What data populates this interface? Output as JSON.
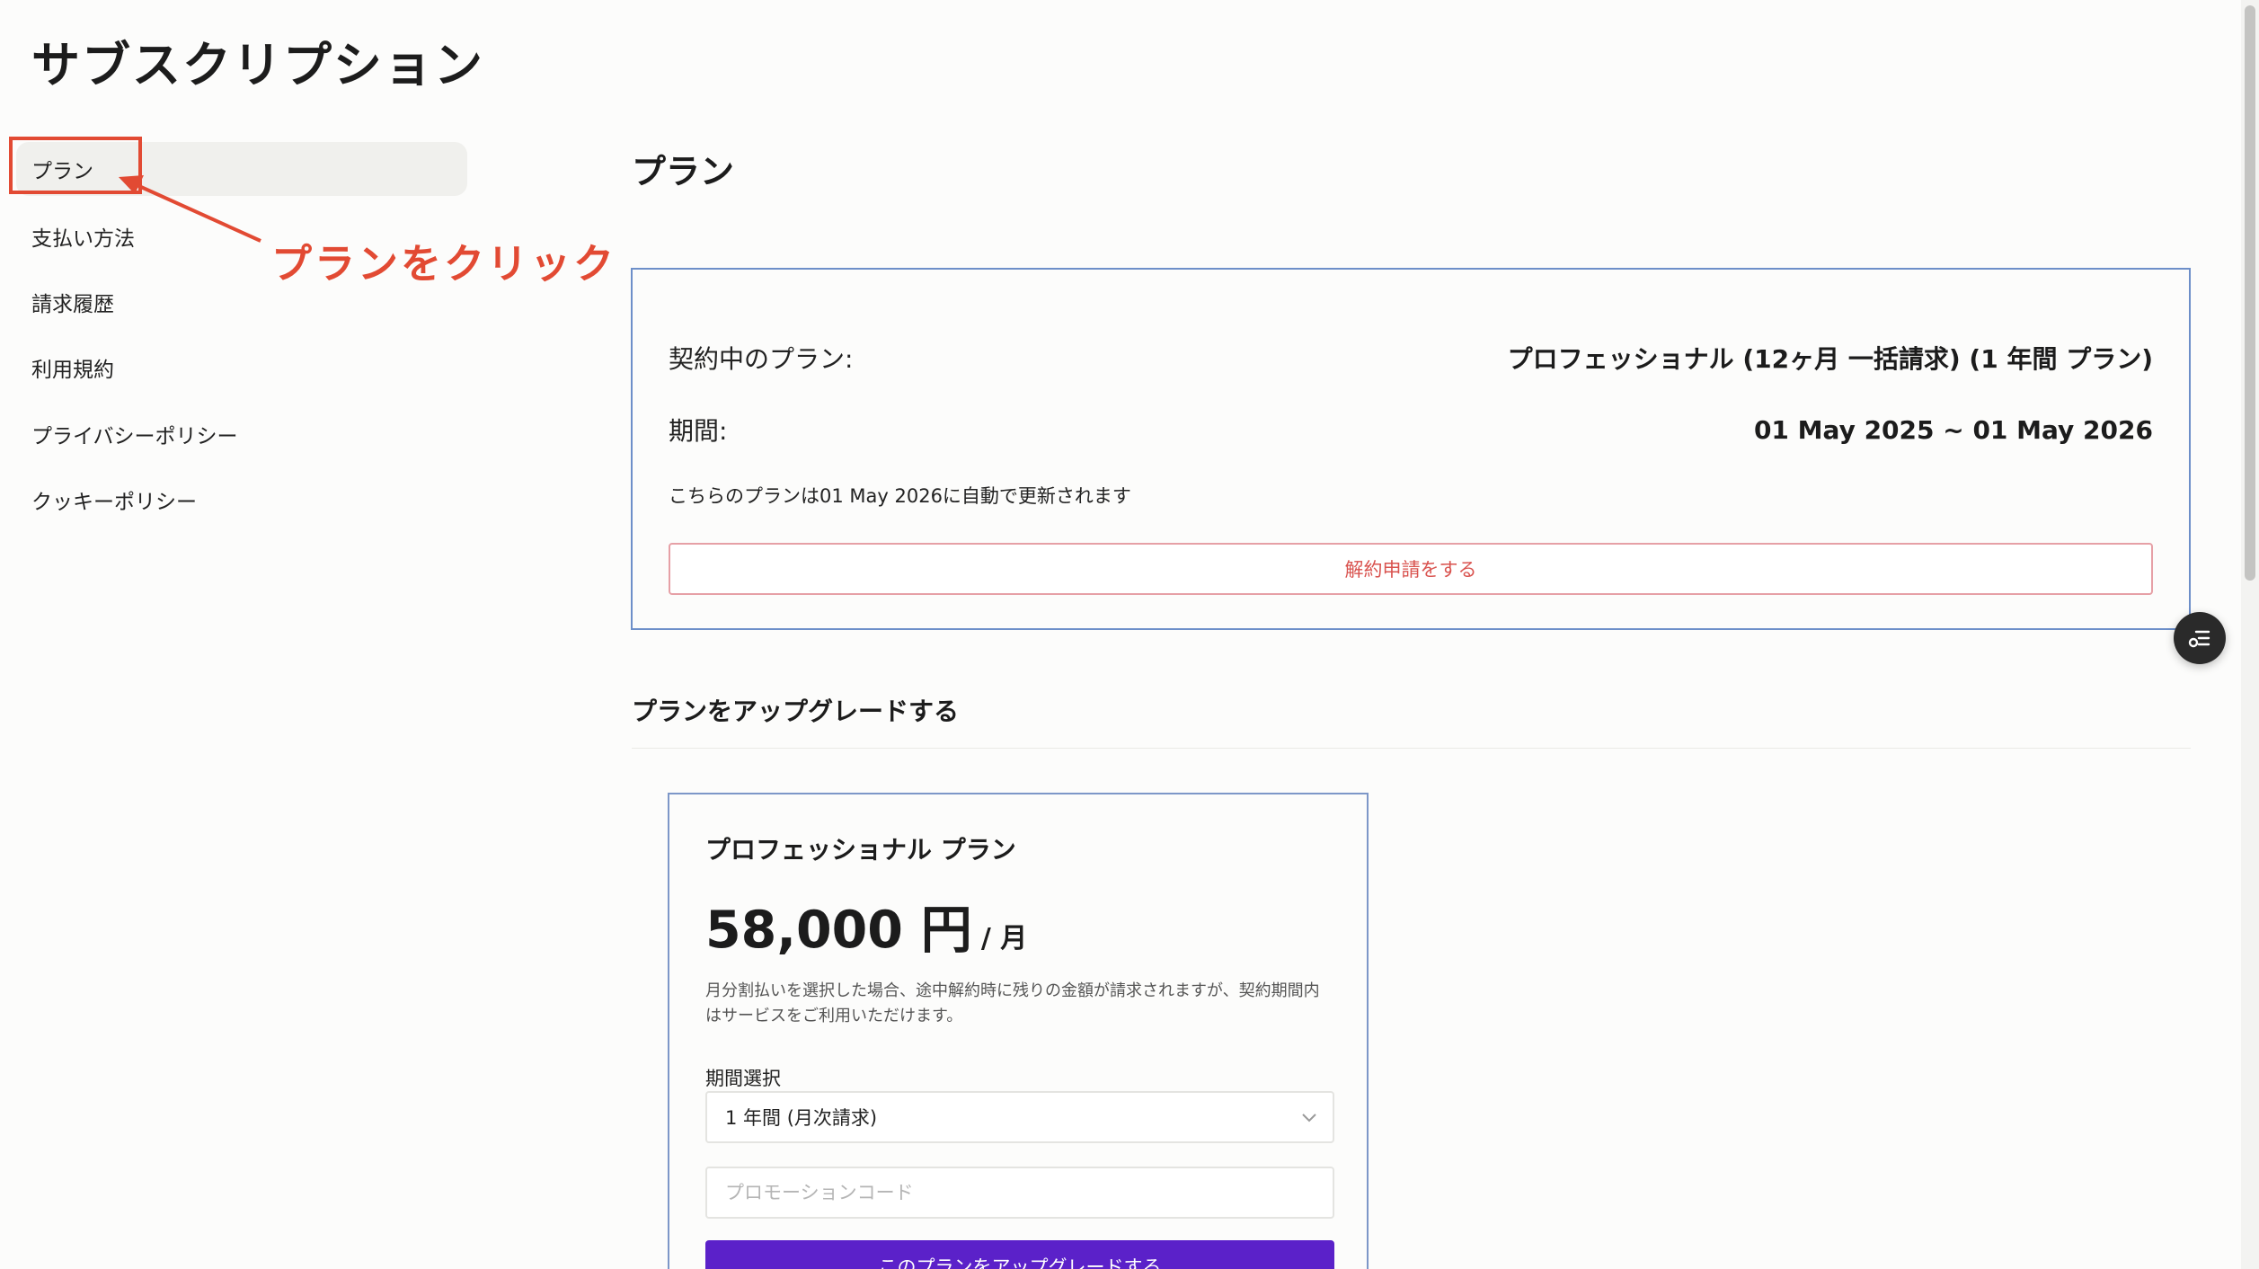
{
  "page_title": "サブスクリプション",
  "sidebar": {
    "items": [
      {
        "label": "プラン",
        "active": true
      },
      {
        "label": "支払い方法"
      },
      {
        "label": "請求履歴"
      },
      {
        "label": "利用規約"
      },
      {
        "label": "プライバシーポリシー"
      },
      {
        "label": "クッキーポリシー"
      }
    ]
  },
  "annotation": {
    "text": "プランをクリック",
    "color": "#e24a33"
  },
  "main": {
    "section_title": "プラン",
    "current_plan": {
      "plan_label": "契約中のプラン:",
      "plan_value": "プロフェッショナル (12ヶ月 一括請求) (1 年間 プラン)",
      "period_label": "期間:",
      "period_value": "01 May 2025 ~ 01 May 2026",
      "renew_note": "こちらのプランは01 May 2026に自動で更新されます",
      "cancel_label": "解約申請をする"
    },
    "upgrade": {
      "title": "プランをアップグレードする",
      "plan_name": "プロフェッショナル プラン",
      "price": "58,000 円",
      "price_unit": "/ 月",
      "note": "月分割払いを選択した場合、途中解約時に残りの金額が請求されますが、契約期間内はサービスをご利用いただけます。",
      "period_select_label": "期間選択",
      "period_select_value": "1 年間 (月次請求)",
      "promo_placeholder": "プロモーションコード",
      "button_label": "このプランをアップグレードする",
      "button_color": "#5b21c9"
    }
  },
  "icons": {
    "fab": "list-settings-icon",
    "select": "chevron-down-icon"
  }
}
